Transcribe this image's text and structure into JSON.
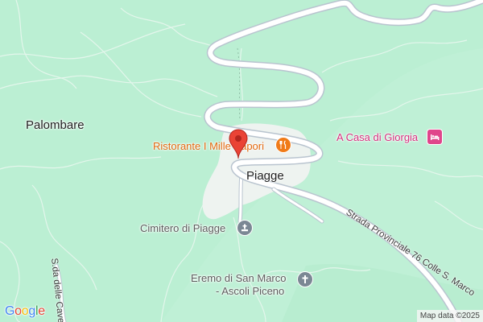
{
  "map": {
    "colors": {
      "terrain": "#bff0d6",
      "terrain_dark": "#a9e5c6",
      "settlement": "#eef3f0",
      "road_fill": "#ffffff",
      "road_casing": "#b9c4cf",
      "trail": "#e7f5ee"
    },
    "labels": {
      "palombare": "Palombare",
      "piagge": "Piagge",
      "restaurant": "Ristorante I Mille Sapori",
      "lodging": "A Casa di Giorgia",
      "cemetery": "Cimitero di Piagge",
      "hermitage_line1": "Eremo di San Marco",
      "hermitage_line2": "- Ascoli Piceno",
      "road_provinciale": "Strada Provinciale 76 Colle S. Marco",
      "road_cave": "S.da delle Cave"
    },
    "icons": {
      "restaurant": "fork-knife-icon",
      "lodging": "bed-icon",
      "cemetery": "memorial-icon",
      "hermitage": "cross-icon",
      "pin": "location-pin-icon"
    },
    "icon_colors": {
      "restaurant": "#f07b18",
      "lodging": "#e0458b",
      "cemetery": "#7b8794",
      "hermitage": "#7b8794",
      "pin": "#ea4335"
    },
    "attribution": "Map data ©2025",
    "logo": "Google"
  }
}
